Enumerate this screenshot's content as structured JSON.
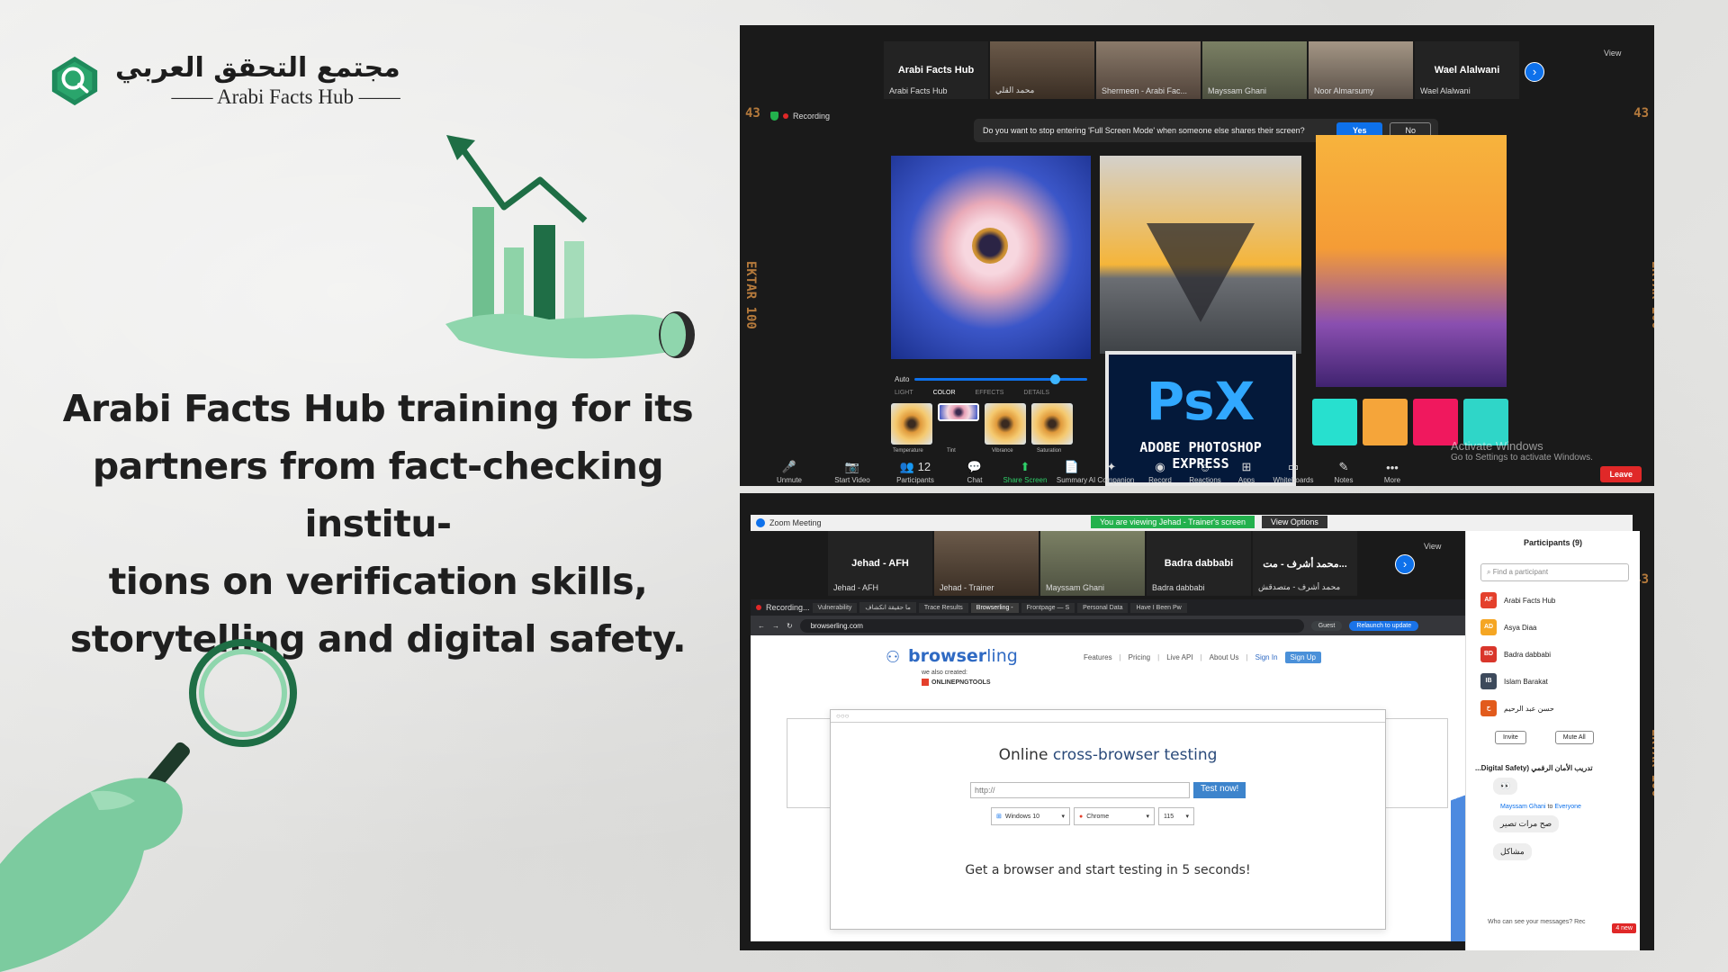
{
  "logo": {
    "arabic": "مجتمع التحقق العربي",
    "english": "—— Arabi Facts Hub ——"
  },
  "headline": {
    "lines": [
      "Arabi Facts Hub training for its",
      "partners from fact-checking institu-",
      "tions on verification skills,",
      "storytelling and digital safety."
    ]
  },
  "colors": {
    "brand_green": "#1e8a5b",
    "light_green": "#7bcf9f",
    "zoom_blue": "#0e71eb",
    "leave_red": "#e02828",
    "film_orange": "#b57a3c"
  },
  "film": {
    "number_top": "43",
    "label": "EKTAR 100"
  },
  "shot1": {
    "top_tiles": [
      {
        "name": "Arabi Facts Hub",
        "caption": "Arabi Facts Hub"
      },
      {
        "name": "",
        "caption": "محمد القلي"
      },
      {
        "name": "",
        "caption": "Shermeen - Arabi Fac..."
      },
      {
        "name": "",
        "caption": "Mayssam Ghani"
      },
      {
        "name": "",
        "caption": "Noor Almarsumy"
      },
      {
        "name": "Wael Alalwani",
        "caption": "Wael Alalwani"
      }
    ],
    "view": "View",
    "recording": "Recording",
    "prompt_text": "Do you want to stop entering 'Full Screen Mode' when someone else shares their screen?",
    "yes": "Yes",
    "no": "No",
    "slider_label": "Auto",
    "filter_tabs": [
      "LIGHT",
      "COLOR",
      "EFFECTS",
      "DETAILS"
    ],
    "thumb_labels": [
      "Temperature",
      "Tint",
      "Vibrance",
      "Saturation"
    ],
    "psx_big": "PsX",
    "psx_small": "ADOBE PHOTOSHOP EXPRESS",
    "color_tiles": [
      "#27e0cf",
      "#f5a53a",
      "#f0185e",
      "#2fd6c8"
    ],
    "toolbar": [
      {
        "label": "Unmute",
        "icon": "mic-off-icon",
        "glyph": "🎤"
      },
      {
        "label": "Start Video",
        "icon": "video-off-icon",
        "glyph": "📷"
      },
      {
        "label": "Participants",
        "icon": "participants-icon",
        "glyph": "👥 12"
      },
      {
        "label": "Chat",
        "icon": "chat-icon",
        "glyph": "💬"
      },
      {
        "label": "Share Screen",
        "icon": "share-screen-icon",
        "glyph": "⬆"
      },
      {
        "label": "Summary",
        "icon": "summary-icon",
        "glyph": "📄"
      },
      {
        "label": "AI Companion",
        "icon": "ai-companion-icon",
        "glyph": "✦"
      },
      {
        "label": "Record",
        "icon": "record-icon",
        "glyph": "◉"
      },
      {
        "label": "Reactions",
        "icon": "reactions-icon",
        "glyph": "☺"
      },
      {
        "label": "Apps",
        "icon": "apps-icon",
        "glyph": "⊞"
      },
      {
        "label": "Whiteboards",
        "icon": "whiteboard-icon",
        "glyph": "▭"
      },
      {
        "label": "Notes",
        "icon": "notes-icon",
        "glyph": "✎"
      },
      {
        "label": "More",
        "icon": "more-icon",
        "glyph": "•••"
      }
    ],
    "leave": "Leave",
    "activate_title": "Activate Windows",
    "activate_sub": "Go to Settings to activate Windows."
  },
  "shot2": {
    "window_title": "Zoom Meeting",
    "viewing": "You are viewing Jehad - Trainer's screen",
    "view_options": "View Options",
    "view": "View",
    "top_tiles": [
      {
        "name": "Jehad - AFH",
        "caption": "Jehad - AFH"
      },
      {
        "name": "",
        "caption": "Jehad - Trainer"
      },
      {
        "name": "",
        "caption": "Mayssam Ghani"
      },
      {
        "name": "Badra dabbabi",
        "caption": "Badra dabbabi"
      },
      {
        "name": "محمد أشرف - مت...",
        "caption": "محمد أشرف - متصدقش"
      }
    ],
    "browser": {
      "recording": "Recording...",
      "tabs": [
        "Vulnerability",
        "ما حقيقة انكشاف",
        "Trace Results",
        "Browserling -",
        "Frontpage — S",
        "Personal Data",
        "Have I Been Pw"
      ],
      "url": "browserling.com",
      "guest": "Guest",
      "relaunch": "Relaunch to update"
    },
    "site": {
      "logo_bold": "browser",
      "logo_rest": "ling",
      "also": "we also created:",
      "opt": "ONLINEPNGTOOLS",
      "nav": [
        "Features",
        "Pricing",
        "Live API",
        "About Us"
      ],
      "signin": "Sign In",
      "signup": "Sign Up",
      "heading_plain": "Online ",
      "heading_blue": "cross-browser testing",
      "input": "http://",
      "test_btn": "Test now!",
      "os": "Windows 10",
      "browser": "Chrome",
      "version": "115",
      "cta": "Get a browser and start testing in 5 seconds!"
    },
    "participants": {
      "title": "Participants (9)",
      "find": "Find a participant",
      "list": [
        {
          "initials": "AF",
          "name": "Arabi Facts Hub",
          "color": "#e4402c"
        },
        {
          "initials": "AD",
          "name": "Asya Diaa",
          "color": "#f5a623"
        },
        {
          "initials": "BD",
          "name": "Badra dabbabi",
          "color": "#d9362b"
        },
        {
          "initials": "IB",
          "name": "Islam Barakat",
          "color": "#3d4a5c"
        },
        {
          "initials": "ح",
          "name": "حسن عبد الرحيم",
          "color": "#e25b1c"
        }
      ],
      "invite": "Invite",
      "mute_all": "Mute All"
    },
    "chat": {
      "title": "تدريب الأمان الرقمي (Digital Safety...",
      "emoji": "👀",
      "from": "Mayssam Ghani",
      "to_word": "to",
      "to": "Everyone",
      "msg1": "صح مرات تصير",
      "msg2": "مشاكل",
      "new": "4 new",
      "who": "Who can see your messages? Rec"
    }
  }
}
